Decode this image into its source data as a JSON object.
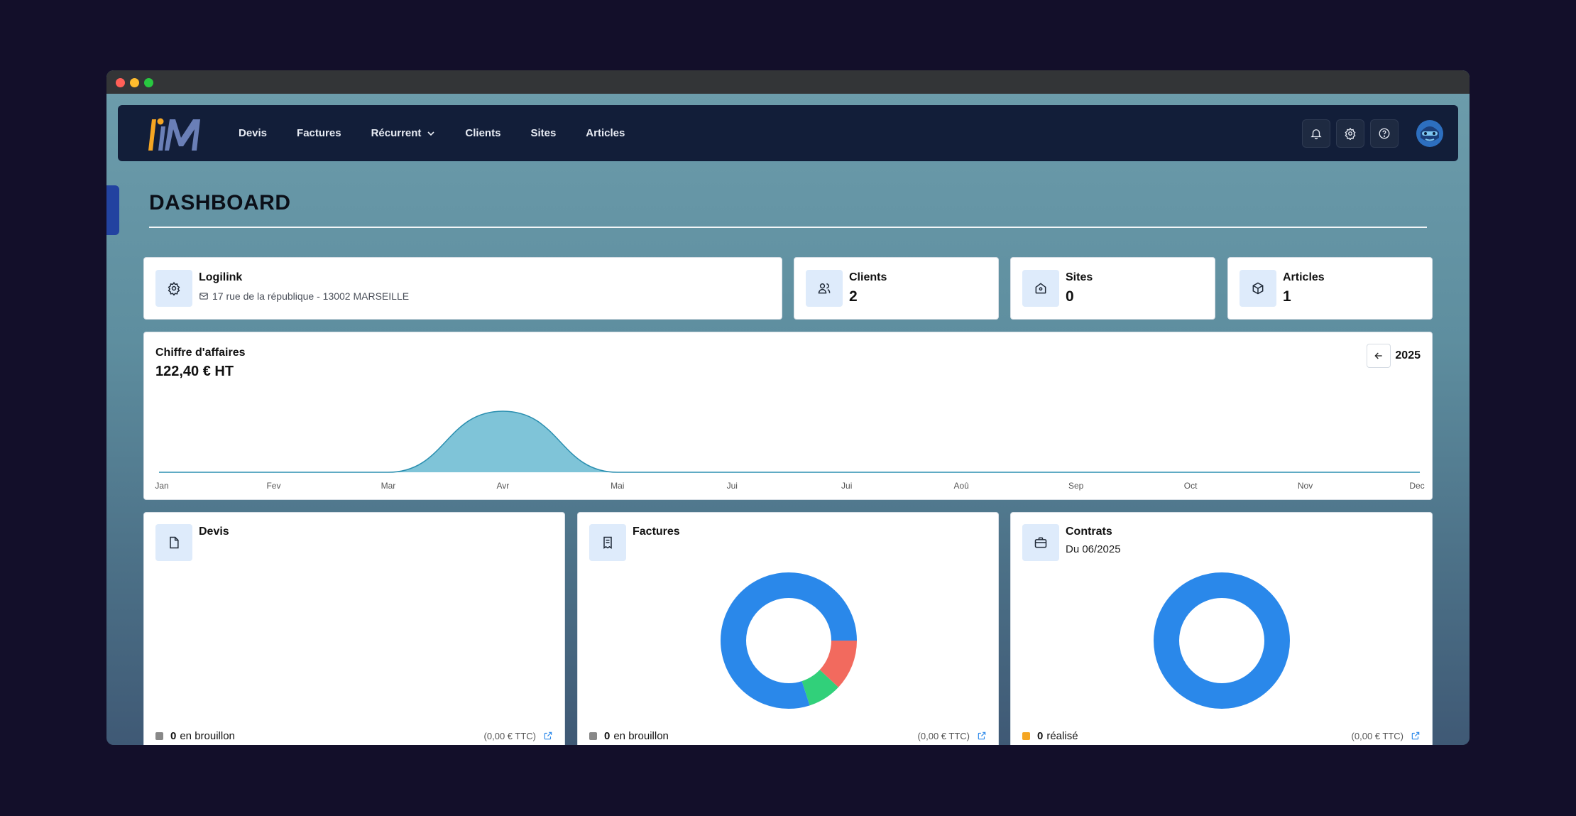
{
  "nav": {
    "items": [
      {
        "label": "Devis"
      },
      {
        "label": "Factures"
      },
      {
        "label": "Récurrent"
      },
      {
        "label": "Clients"
      },
      {
        "label": "Sites"
      },
      {
        "label": "Articles"
      }
    ]
  },
  "page": {
    "title": "DASHBOARD"
  },
  "company": {
    "name": "Logilink",
    "address": "17 rue de la république - 13002 MARSEILLE"
  },
  "stats": {
    "clients": {
      "label": "Clients",
      "value": "2"
    },
    "sites": {
      "label": "Sites",
      "value": "0"
    },
    "articles": {
      "label": "Articles",
      "value": "1"
    }
  },
  "revenue": {
    "label": "Chiffre d'affaires",
    "value": "122,40 € HT",
    "year": "2025"
  },
  "chart_data": {
    "type": "area",
    "categories": [
      "Jan",
      "Fev",
      "Mar",
      "Avr",
      "Mai",
      "Jui",
      "Jui",
      "Aoû",
      "Sep",
      "Oct",
      "Nov",
      "Dec"
    ],
    "values": [
      0,
      0,
      0,
      122.4,
      0,
      0,
      0,
      0,
      0,
      0,
      0,
      0
    ],
    "fill_color": "#7fc4d8",
    "line_color": "#2b8fb0"
  },
  "panels": {
    "devis": {
      "title": "Devis",
      "count": "0",
      "status": "en brouillon",
      "amount": "(0,00 € TTC)",
      "legend_color": "#888888"
    },
    "factures": {
      "title": "Factures",
      "count": "0",
      "status": "en brouillon",
      "amount": "(0,00 € TTC)",
      "legend_color": "#888888",
      "donut": [
        {
          "color": "#2a88ea",
          "value": 80
        },
        {
          "color": "#f26a5e",
          "value": 12
        },
        {
          "color": "#31d07a",
          "value": 8
        }
      ]
    },
    "contrats": {
      "title": "Contrats",
      "subtitle": "Du 06/2025",
      "count": "0",
      "status": "réalisé",
      "amount": "(0,00 € TTC)",
      "legend_color": "#f5a623",
      "donut": [
        {
          "color": "#2a88ea",
          "value": 100
        }
      ]
    }
  }
}
